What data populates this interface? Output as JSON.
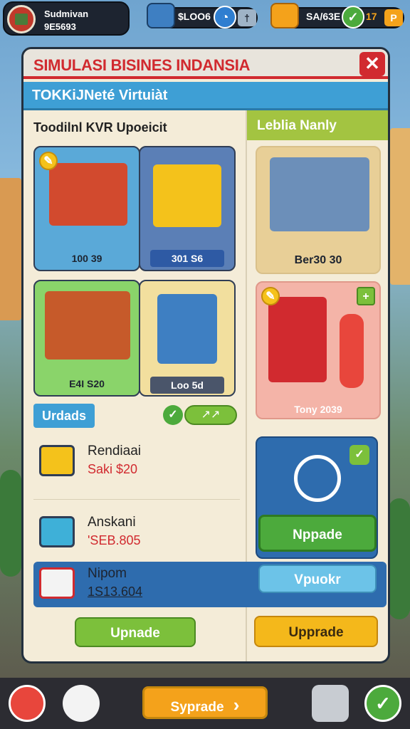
{
  "topbar": {
    "player_name": "Sudmivan",
    "player_id": "9E5693",
    "cash_value": "$LOO6",
    "cash_plus": "†",
    "gems_value": "SA/63E",
    "gems_count": "17",
    "gems_plus": "P"
  },
  "panel": {
    "title": "SIMULASI BISINES INDANSIA",
    "close": "✕",
    "subtitle": "TOKKiJNeté Virtuiàt",
    "left_heading": "Toodilnl KVR Upoeicit",
    "right_heading": "Leblia Nanly"
  },
  "cards": [
    {
      "label": "100 39"
    },
    {
      "label": "301 S6"
    },
    {
      "label": "Ber30 30"
    },
    {
      "label": "E4I S20"
    },
    {
      "label": "Loo 5d"
    },
    {
      "label": "Tony 2039"
    }
  ],
  "upgrades": {
    "label": "Urdads",
    "progress_icon": "↗↗"
  },
  "items": [
    {
      "name": "Rendiaai",
      "value": "Saki $20"
    },
    {
      "name": "Anskani",
      "value": "'SEB.805"
    },
    {
      "name": "Nipom",
      "value": "1S13.604"
    }
  ],
  "right_box": {
    "button": "Nppade",
    "vpuckr": "Vpuokr"
  },
  "buttons": {
    "upgrade_left": "Upnade",
    "upgrade_right": "Upprade"
  },
  "navbar": {
    "main_button": "Syprade",
    "main_arrow": "›"
  },
  "colors": {
    "title_red": "#d12a2f",
    "sub_blue": "#3e9fd5",
    "green": "#6fbf3a",
    "orange": "#f4a21b"
  }
}
